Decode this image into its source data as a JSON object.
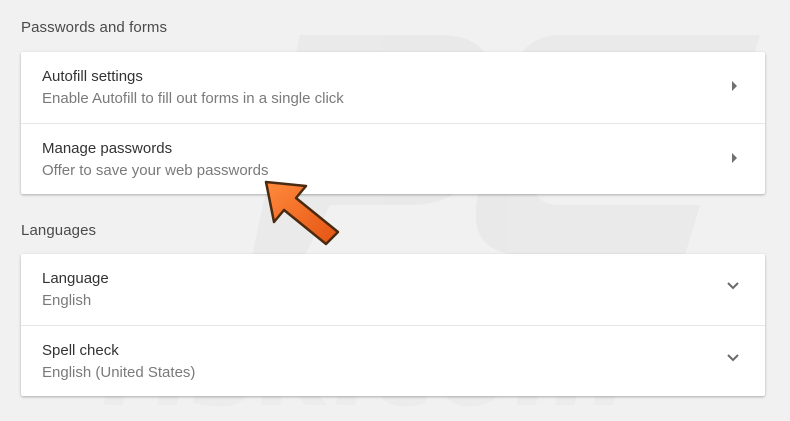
{
  "sections": [
    {
      "title": "Passwords and forms",
      "rows": [
        {
          "title": "Autofill settings",
          "subtitle": "Enable Autofill to fill out forms in a single click"
        },
        {
          "title": "Manage passwords",
          "subtitle": "Offer to save your web passwords"
        }
      ]
    },
    {
      "title": "Languages",
      "rows": [
        {
          "title": "Language",
          "subtitle": "English"
        },
        {
          "title": "Spell check",
          "subtitle": "English (United States)"
        }
      ]
    }
  ],
  "watermark": {
    "text": "PC risk.com"
  },
  "colors": {
    "background": "#f1f1f1",
    "card": "#ffffff",
    "accent_arrow": "#f26c2a",
    "arrow_outline": "#4a2a10"
  },
  "icons": {
    "row_nav": "triangle-right-icon",
    "row_expand": "chevron-down-icon",
    "pointer": "orange-pointer-arrow-icon"
  }
}
